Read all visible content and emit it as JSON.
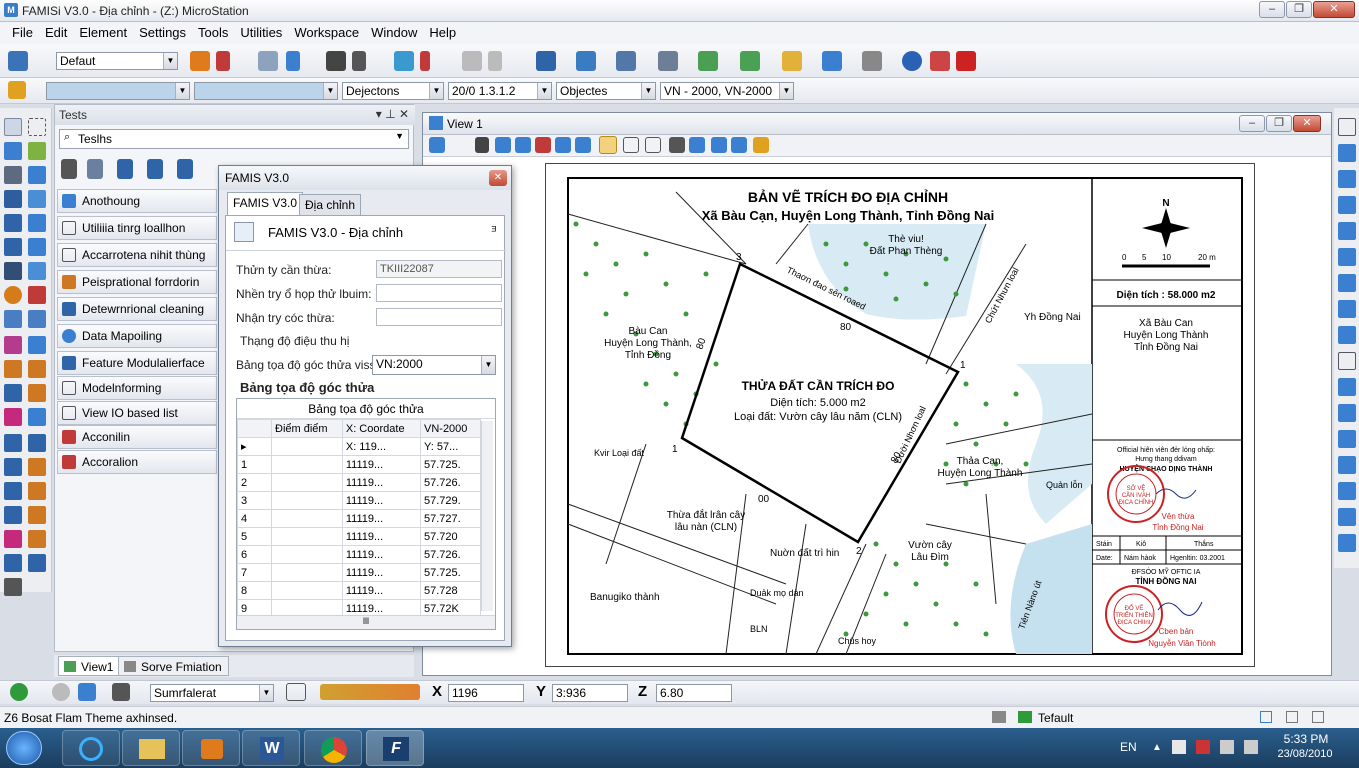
{
  "window": {
    "title": "FAMISi V3.0 - Địa chỉnh - (Z:) MicroStation"
  },
  "menu": [
    "File",
    "Edit",
    "Element",
    "Settings",
    "Tools",
    "Utilities",
    "Workspace",
    "Window",
    "Help"
  ],
  "toolbar": {
    "model_combo": "Defaut",
    "level_combo": "Dejectons",
    "version_combo": "20/0 1.3.1.2",
    "object_combo": "Objectes",
    "crs_combo": "VN - 2000, VN-2000"
  },
  "tasks": {
    "title": "Tests",
    "search": "Teslhs",
    "items": [
      "Anothoung",
      "Utiliiia tinrg loallhon",
      "Accarrotena nihit thùng",
      "Peisprational forrdorin",
      "Detewrnrional cleaning",
      "Data Mapoiling",
      "Feature Modulalierface",
      "Modelnforming",
      "View IO based list",
      "Acconilin",
      "Accoralion"
    ]
  },
  "bottom_tabs": [
    "View1",
    "Sorve Fmiation"
  ],
  "view": {
    "title": "View 1"
  },
  "famis": {
    "title": "FAMIS V3.0",
    "tabs": [
      "FAMIS V3.0",
      "Địa chỉnh"
    ],
    "header": "FAMIS V3.0 - Địa chỉnh",
    "fields": [
      {
        "label": "Thửn ty cần thừa:",
        "value": "TKIII22087"
      },
      {
        "label": "Nhền try ổ họp thử lbuim:",
        "value": ""
      },
      {
        "label": "Nhận try cóc thừa:",
        "value": ""
      }
    ],
    "section": "Thạng độ điệu thu hị",
    "crs_label": "Bảng tọa độ góc thửa viss:",
    "crs_value": "VN:2000",
    "table_title": "Bảng tọa độ góc thửa",
    "table_caption": "Bảng tọa độ góc thửa",
    "columns": [
      "Điểm điểm",
      "X: Coordate",
      "VN-2000"
    ],
    "header_row": [
      "X: 119...",
      "Y: 57..."
    ],
    "rows": [
      [
        "1",
        "11119...",
        "57.725."
      ],
      [
        "2",
        "11119...",
        "57.726."
      ],
      [
        "3",
        "11119...",
        "57.729."
      ],
      [
        "4",
        "11119...",
        "57.727."
      ],
      [
        "5",
        "11119...",
        "57.720"
      ],
      [
        "6",
        "11119...",
        "57.726."
      ],
      [
        "7",
        "11119...",
        "57.725."
      ],
      [
        "8",
        "11119...",
        "57.728"
      ],
      [
        "9",
        "11119...",
        "57.72K"
      ]
    ],
    "scroll_mark": "lll"
  },
  "map": {
    "title": "BẢN VẼ TRÍCH ĐO ĐỊA CHỈNH",
    "subtitle": "Xã Bàu Cạn, Huyện Long Thành, Tỉnh Đồng Nai",
    "parcel": {
      "title": "THỬA ĐẤT CẦN TRÍCH ĐO",
      "area": "Diện tích: 5.000 m2",
      "type": "Loại đất: Vườn cây lâu năm (CLN)"
    },
    "labels": {
      "bau_can": "Bàu Can\nHuyện Long Thành,\nTỉnh Đồng",
      "the_viu": "Thè viu!\nĐất Phan Thèng",
      "road1": "Thaơn đao sên roaed",
      "road2": "Chứt Nhưn loal",
      "road3": "Đười Nhơn loal",
      "yh_dong_nai": "Yh Đồng Nai",
      "kvir": "Kvir Loại đất",
      "thua_dat": "Thừa đắt lrân cây\nlâu nàn (CLN)",
      "vuon_dat": "Nuờn đất trì hin",
      "thaa_can": "Thảa Cạn,\nHuyện Long Thành",
      "quan_tin": "Quản lỗn",
      "vuon_cay": "Vườn cây\nLâu Đìm",
      "banug": "Banugiko thành",
      "duak": "Duảk mọ dản",
      "bln": "BLN",
      "chus": "Chûs hoy",
      "sao_sea": "Tiẻn Nàno út",
      "pt1": "1",
      "pt2": "2",
      "pt3": "3",
      "pt1b": "1",
      "len_80a": "80",
      "len_80b": "80",
      "len_80c": "80",
      "len_80d": "00"
    },
    "north": "N",
    "scale": [
      "0",
      "5",
      "10",
      "20 m"
    ],
    "area_box": "Diện tích : 58.000 m2",
    "address": "Xã Bàu Can\nHuyện Long Thành\nTỉnh Đồng Nai",
    "stamp1": {
      "line1": "Official hiên viên đẻr lóng ohấp:",
      "line2": "Hưng thang ddivam",
      "line3": "HUYỆN CHẠO DỊNG THÀNH",
      "line4": "Vên thừa",
      "line5": "Tỉnh Đồng Nai"
    },
    "grid": {
      "h1": "Stáin",
      "h2": "Kiô",
      "h3": "Thắns",
      "r1": "Date:",
      "r2": "Nám hàok",
      "r3": "Hgenltin: 03.2001"
    },
    "stamp2": {
      "line1": "ĐFSÓO MỸ OFTIC IA",
      "line2": "TỈNH ĐỒNG NAI",
      "line3": "Cben bản",
      "line4": "Nguyễn Viân Tiònh"
    },
    "seal1": "SỞ VỆ\nCẦN IVÀH\nĐỊCA CHỈNH",
    "seal2": "ĐỔ VẼ\nTRIÊN THIÊN\nĐỊCA CHIInt"
  },
  "status": {
    "snap_combo": "Sumrfalerat",
    "x": "1196",
    "y": "3:936",
    "z": "6.80",
    "message": "Z6 Bosat Flam Theme axhinsed.",
    "level": "Tefault"
  },
  "taskbar": {
    "lang": "EN",
    "time": "5:33 PM",
    "date": "23/08/2010"
  }
}
